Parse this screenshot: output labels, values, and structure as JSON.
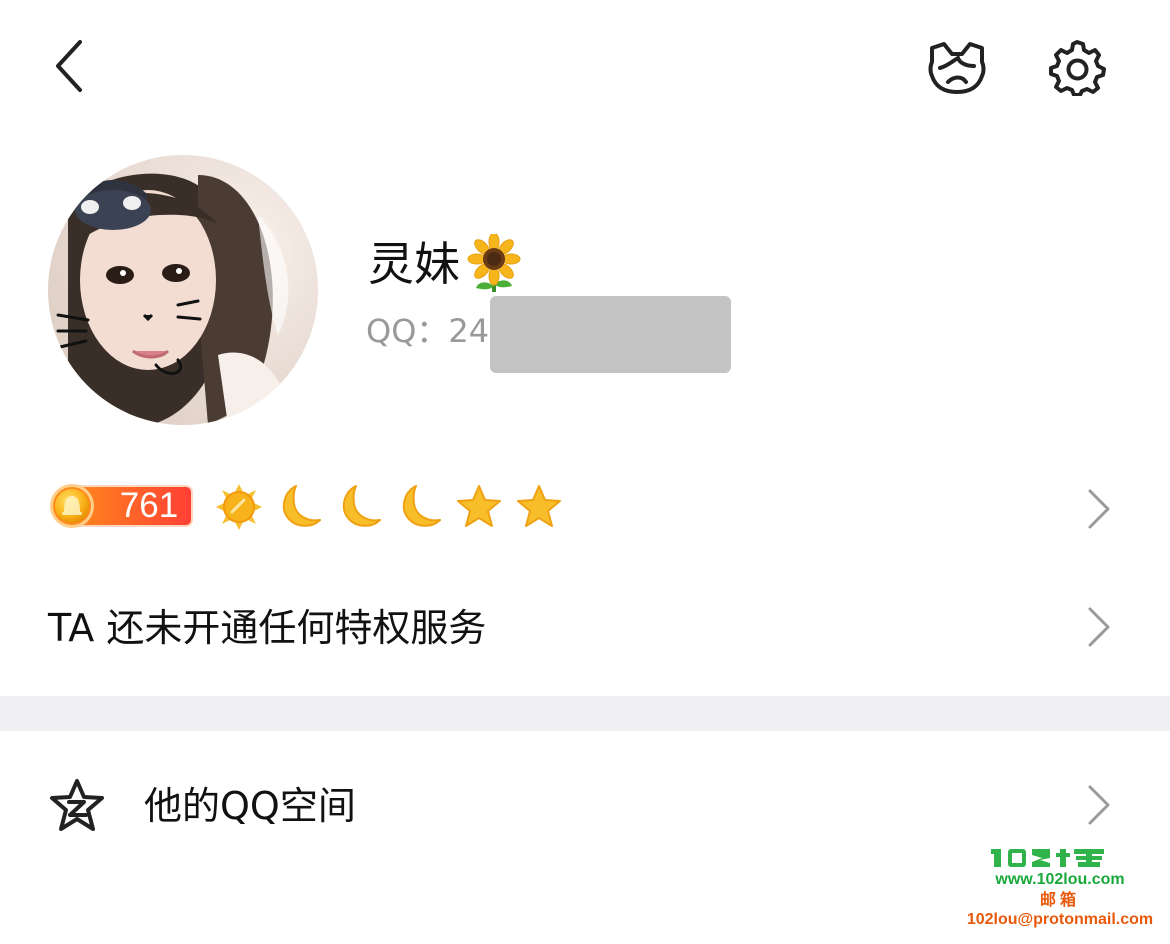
{
  "header": {
    "back_icon": "back-arrow-icon",
    "face_icon": "profile-face-icon",
    "settings_icon": "gear-icon"
  },
  "profile": {
    "nickname": "灵妹",
    "nickname_emoji": "sunflower",
    "qq_label": "QQ：24",
    "qq_number_redacted": true
  },
  "level": {
    "badge_value": "761",
    "badge_colors": {
      "start": "#ff7b1c",
      "end": "#ff3d3d"
    },
    "icons": [
      "sun-icon",
      "moon-icon",
      "moon-icon",
      "moon-icon",
      "star-icon",
      "star-icon"
    ]
  },
  "privilege": {
    "text": "TA 还未开通任何特权服务"
  },
  "qzone": {
    "icon": "qzone-star-icon",
    "label": "他的QQ空间"
  },
  "watermark": {
    "logo_text": "102楼",
    "url": "www.102lou.com",
    "mail_label": "邮箱",
    "email": "102lou@protonmail.com"
  },
  "colors": {
    "accent_orange": "#ff6a00",
    "level_gold": "#f7b418",
    "divider": "#efeff4",
    "secondary_text": "#999999",
    "watermark_green": "#1aa83c",
    "watermark_orange": "#e8590c"
  }
}
